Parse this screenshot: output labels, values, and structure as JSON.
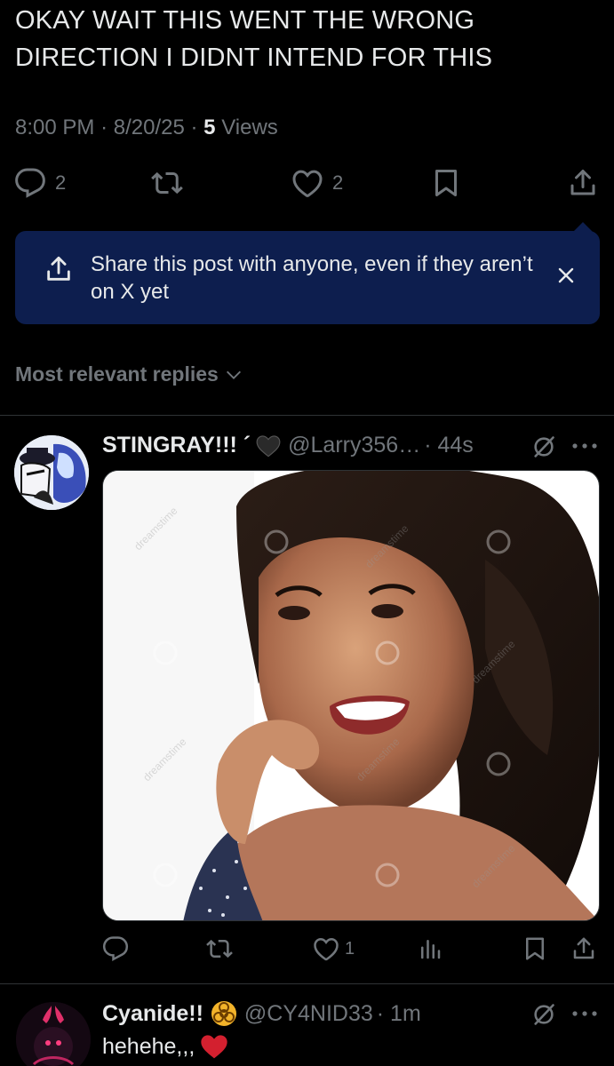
{
  "post": {
    "text_line1": "OKAY WAIT THIS WENT THE WRONG",
    "text_line2": "DIRECTION I DIDNT INTEND FOR THIS",
    "time": "8:00 PM",
    "date": "8/20/25",
    "views_count": "5",
    "views_label": "Views",
    "separator": "·"
  },
  "actions": {
    "replies": "2",
    "reposts": "",
    "likes": "2"
  },
  "tooltip": {
    "message": "Share this post with anyone, even if they aren’t on X yet"
  },
  "replies_filter": {
    "label": "Most relevant replies"
  },
  "reply1": {
    "name": "STINGRAY!!! ´",
    "handle": "@Larry356…",
    "time": "· 44s",
    "likes": "1",
    "image_watermark": "dreamstime"
  },
  "reply2": {
    "name": "Cyanide!!",
    "handle": "@CY4NID33",
    "time": "· 1m",
    "text": "hehehe,,,"
  },
  "colors": {
    "background": "#000000",
    "text": "#e7e9ea",
    "muted": "#71767b",
    "tooltip_bg": "#0d1e4e",
    "divider": "#2f3336",
    "verified_badge": "#f2b32a",
    "heart_emoji": "#d3202f"
  },
  "icons": [
    "reply-icon",
    "repost-icon",
    "like-icon",
    "bookmark-icon",
    "share-icon",
    "close-icon",
    "chevron-down-icon",
    "grok-icon",
    "more-icon",
    "views-chart-icon",
    "black-heart-emoji",
    "biohazard-badge-icon",
    "red-heart-emoji"
  ]
}
